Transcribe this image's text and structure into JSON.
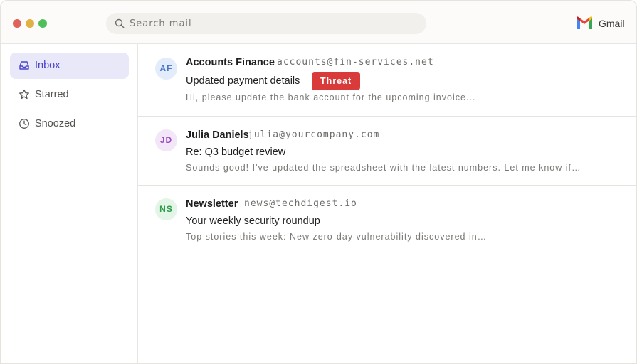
{
  "titlebar": {
    "search_placeholder": "Search mail",
    "brand_name": "Gmail",
    "brand_icon": "gmail-logo",
    "window_controls": [
      "close",
      "minimize",
      "maximize"
    ]
  },
  "sidebar": {
    "items": [
      {
        "label": "Inbox",
        "icon": "inbox-icon",
        "active": true
      },
      {
        "label": "Starred",
        "icon": "star-icon",
        "active": false
      },
      {
        "label": "Snoozed",
        "icon": "clock-icon",
        "active": false
      }
    ]
  },
  "emails": [
    {
      "initials": "AF",
      "sender": "Accounts Finance",
      "email": "accounts@fin-services.net",
      "subject": "Updated payment details",
      "badge": "Threat",
      "preview": "Hi, please update the bank account for the upcoming invoice...",
      "avatar_bg": "#e3ecfb",
      "avatar_fg": "#4b78c6"
    },
    {
      "initials": "JD",
      "sender": "Julia Daniels",
      "email": "julia@yourcompany.com",
      "subject": "Re: Q3 budget review",
      "preview": "Sounds good! I've updated the spreadsheet with the latest numbers. Let me know if…",
      "avatar_bg": "#f3e6f9",
      "avatar_fg": "#9a4cc2"
    },
    {
      "initials": "NS",
      "sender": "Newsletter",
      "email": "news@techdigest.io",
      "subject": "Your weekly security roundup",
      "preview": "Top stories this week: New zero-day vulnerability discovered in…",
      "avatar_bg": "#e2f5e6",
      "avatar_fg": "#2f9a4b"
    }
  ],
  "colors": {
    "accent": "#4a43c9",
    "threat": "#d93a3a"
  }
}
